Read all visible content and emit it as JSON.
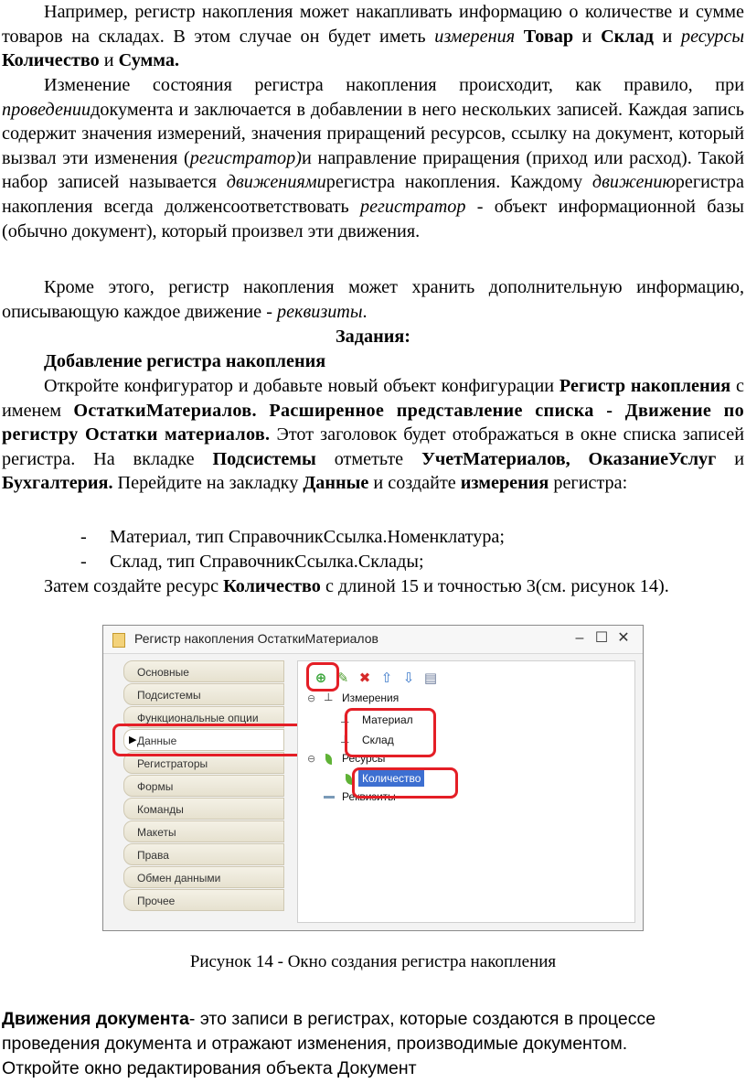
{
  "p1": {
    "t1": "Например, регистр накопления может накапливать информацию о количестве и сумме товаров на складах. В этом случае он будет иметь ",
    "i1": "измерения",
    "b1": "Товар",
    "t2": " и ",
    "b2": "Склад",
    "t3": " и ",
    "i2": "ресурсы",
    "b3": "Количество",
    "t4": " и ",
    "b4": "Сумма."
  },
  "p2": {
    "t1": "Изменение состояния регистра накопления происходит, как правило, при ",
    "i1": "проведении",
    "t2": "документа и заключается в добавлении в него нескольких записей. Каждая запись содержит значения измерений, значения приращений ресурсов, ссылку на документ, который вызвал эти изменения (",
    "i2": "регистратор)",
    "t3": "и направление приращения (приход или расход). Такой набор записей называется ",
    "i3": "движениями",
    "t4": "регистра накопления. Каждому ",
    "i4": "движению",
    "t5": "регистра накопления всегда долженсоответствовать ",
    "i5": "регистратор",
    "t6": " - объект информационной базы (обычно документ), который произвел эти движения."
  },
  "p3": {
    "t1": "Кроме этого, регистр накопления может хранить дополнительную информацию, описывающую каждое движение - ",
    "i1": "реквизиты",
    "t2": "."
  },
  "tasks_heading": "Задания:",
  "section_heading": "Добавление регистра накопления",
  "p4": {
    "t1": "Откройте конфигуратор и добавьте новый объект конфигурации ",
    "b1": "Регистр накопления",
    "t2": " с именем ",
    "b2": "ОстаткиМатериалов. Расширенное представление списка - Движение по регистру Остатки материалов.",
    "t3": " Этот заголовок будет отображаться в окне списка записей регистра. На вкладке ",
    "b3": "Подсистемы",
    "t4": " отметьте ",
    "b4": "УчетМатериалов, ОказаниеУслуг",
    "t5": " и ",
    "b5": "Бухгалтерия.",
    "t6": " Перейдите на закладку ",
    "b6": "Данные",
    "t7": " и создайте ",
    "b7": "измерения",
    "t8": " регистра:"
  },
  "list": [
    "Материал, тип СправочникСсылка.Номенклатура;",
    "Склад, тип СправочникСсылка.Склады;"
  ],
  "list_dash": "-",
  "p5": {
    "t1": "Затем создайте ресурс ",
    "b1": "Количество",
    "t2": " с длиной 15 и точностью 3(см. рисунок 14)."
  },
  "window": {
    "title": "Регистр накопления ОстаткиМатериалов",
    "controls": [
      "–",
      "☐",
      "✕"
    ],
    "nav": [
      "Основные",
      "Подсистемы",
      "Функциональные опции",
      "Данные",
      "Регистраторы",
      "Формы",
      "Команды",
      "Макеты",
      "Права",
      "Обмен данными",
      "Прочее"
    ],
    "selected_nav": "Данные",
    "tree": {
      "dimensions_label": "Измерения",
      "dimensions": [
        "Материал",
        "Склад"
      ],
      "resources_label": "Ресурсы",
      "resources": [
        "Количество"
      ],
      "attributes_label": "Реквизиты"
    },
    "colors": {
      "highlight": "#e41e26",
      "selection": "#3d6fd1",
      "add": "#3aa53a"
    }
  },
  "caption": "Рисунок 14 - Окно создания регистра накопления",
  "p6": {
    "b1": "Движения документа",
    "t1": "- это записи в регистрах, которые создаются в процессе проведения документа и отражают изменения, производимые документом."
  },
  "p7": "Откройте окно редактирования объекта Документ"
}
